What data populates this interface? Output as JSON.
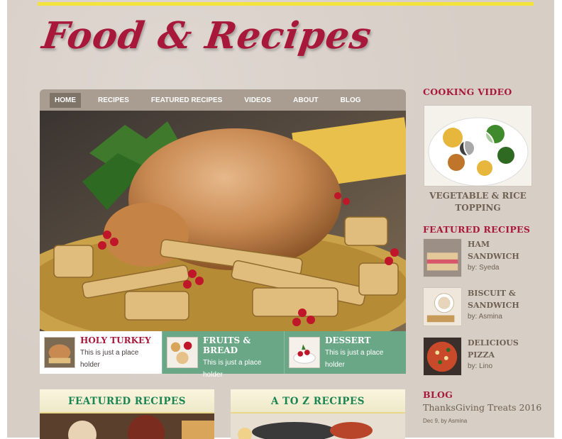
{
  "site": {
    "title": "Food & Recipes"
  },
  "nav": {
    "items": [
      "HOME",
      "RECIPES",
      "FEATURED RECIPES",
      "VIDEOS",
      "ABOUT",
      "BLOG"
    ],
    "active": "HOME"
  },
  "cards": [
    {
      "title": "HOLY TURKEY",
      "desc": "This is just a place holder"
    },
    {
      "title": "FRUITS & BREAD",
      "desc": "This is just a place holder"
    },
    {
      "title": "DESSERT",
      "desc": "This is just a place holder"
    }
  ],
  "panels": {
    "featured": "FEATURED RECIPES",
    "atoz": "A TO Z RECIPES"
  },
  "sidebar": {
    "video_heading": "COOKING VIDEO",
    "video_caption": "VEGETABLE & RICE TOPPING",
    "featured_heading": "FEATURED RECIPES",
    "recipes": [
      {
        "name": "HAM SANDWICH",
        "by": "by: Syeda"
      },
      {
        "name": "BISCUIT & SANDWICH",
        "by": "by: Asmina"
      },
      {
        "name": "DELICIOUS PIZZA",
        "by": "by: Lino"
      }
    ],
    "blog_heading": "BLOG",
    "blog_post": "ThanksGiving Treats 2016",
    "blog_meta": "Dec 9, by Asmina"
  },
  "colors": {
    "brand": "#a8183b",
    "green": "#6aa786",
    "accent": "#1a8552",
    "top_bar": "#f3e33a"
  },
  "icons": {
    "video_play": "play-icon"
  }
}
